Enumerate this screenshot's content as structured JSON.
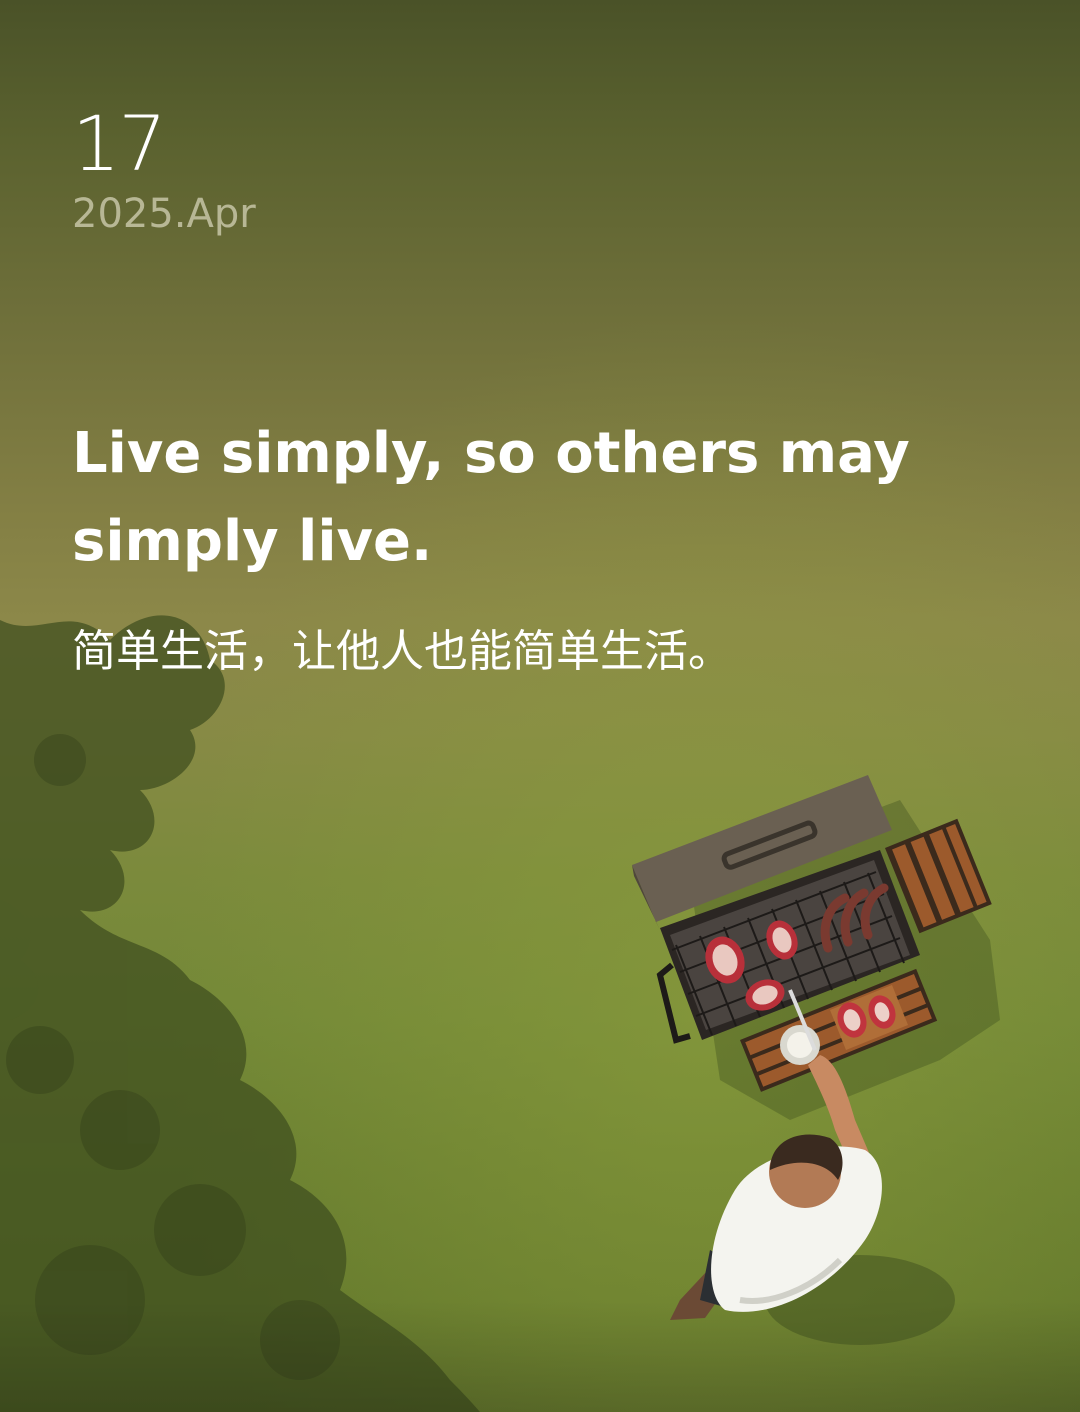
{
  "calendar": {
    "day": "17",
    "year_month": "2025.Apr"
  },
  "quote": {
    "english": "Live simply, so others may simply live.",
    "chinese": "简单生活，让他人也能简单生活。"
  },
  "illustration": {
    "subject": "man grilling meat on a barbecue, top-down view"
  }
}
